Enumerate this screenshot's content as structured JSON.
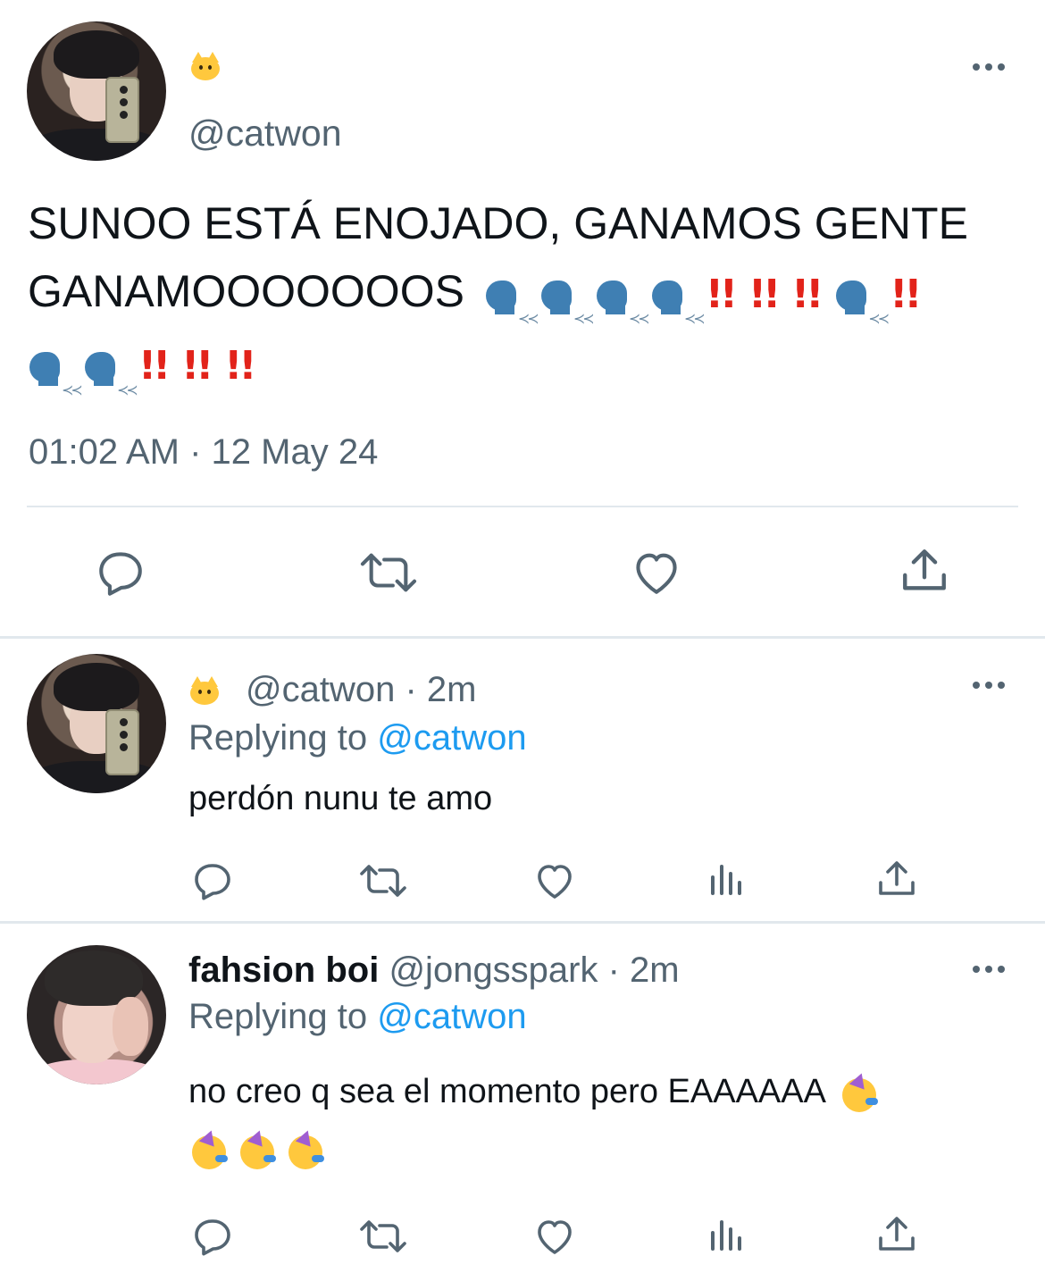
{
  "main_tweet": {
    "display_name_emoji": "cat-face-emoji",
    "handle": "@catwon",
    "text_line1": "SUNOO ESTÁ ENOJADO, GANAMOS GENTE",
    "text_line2": "GANAMOOOOOOOS",
    "timestamp": "01:02 AM · 12 May 24",
    "actions": [
      "reply-icon",
      "retweet-icon",
      "like-icon",
      "share-icon"
    ]
  },
  "replies": [
    {
      "display_name_emoji": "cat-face-emoji",
      "meta": "@catwon · 2m",
      "replying_label": "Replying to",
      "replying_handle": "@catwon",
      "text": "perdón nunu te amo",
      "actions": [
        "reply-icon",
        "retweet-icon",
        "like-icon",
        "analytics-icon",
        "share-icon"
      ]
    },
    {
      "name": "fahsion boi",
      "meta": "@jongsspark · 2m",
      "replying_label": "Replying to",
      "replying_handle": "@catwon",
      "text": "no creo q sea el momento pero EAAAAAA",
      "actions": [
        "reply-icon",
        "retweet-icon",
        "like-icon",
        "analytics-icon",
        "share-icon"
      ]
    }
  ],
  "colors": {
    "text": "#0f1419",
    "secondary": "#536471",
    "link": "#1d9bf0",
    "divider": "#e1e8ed"
  }
}
